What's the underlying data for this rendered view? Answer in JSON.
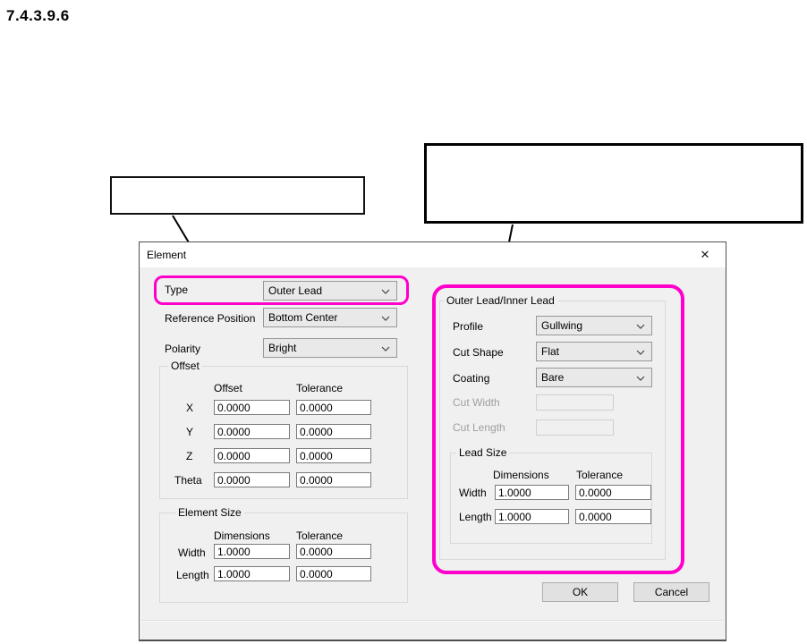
{
  "page": {
    "section_number": "7.4.3.9.6"
  },
  "colors": {
    "highlight": "#ff00cc",
    "dialog_bg": "#f0f0f0",
    "titlebar_bg": "#ffffff"
  },
  "callouts": {
    "left_text": "",
    "right_text": ""
  },
  "dialog": {
    "title": "Element",
    "close_icon": "✕",
    "fields": {
      "type": {
        "label": "Type",
        "value": "Outer Lead"
      },
      "reference_position": {
        "label": "Reference Position",
        "value": "Bottom Center"
      },
      "polarity": {
        "label": "Polarity",
        "value": "Bright"
      }
    },
    "offset_group": {
      "title": "Offset",
      "col1_header": "Offset",
      "col2_header": "Tolerance",
      "rows": [
        {
          "label": "X",
          "offset": "0.0000",
          "tolerance": "0.0000"
        },
        {
          "label": "Y",
          "offset": "0.0000",
          "tolerance": "0.0000"
        },
        {
          "label": "Z",
          "offset": "0.0000",
          "tolerance": "0.0000"
        },
        {
          "label": "Theta",
          "offset": "0.0000",
          "tolerance": "0.0000"
        }
      ]
    },
    "element_size_group": {
      "title": "Element Size",
      "col1_header": "Dimensions",
      "col2_header": "Tolerance",
      "rows": [
        {
          "label": "Width",
          "dimensions": "1.0000",
          "tolerance": "0.0000"
        },
        {
          "label": "Length",
          "dimensions": "1.0000",
          "tolerance": "0.0000"
        }
      ]
    },
    "lead_group": {
      "title": "Outer Lead/Inner Lead",
      "profile": {
        "label": "Profile",
        "value": "Gullwing"
      },
      "cut_shape": {
        "label": "Cut Shape",
        "value": "Flat"
      },
      "coating": {
        "label": "Coating",
        "value": "Bare"
      },
      "cut_width": {
        "label": "Cut Width",
        "value": ""
      },
      "cut_length": {
        "label": "Cut Length",
        "value": ""
      },
      "lead_size_group": {
        "title": "Lead Size",
        "col1_header": "Dimensions",
        "col2_header": "Tolerance",
        "rows": [
          {
            "label": "Width",
            "dimensions": "1.0000",
            "tolerance": "0.0000"
          },
          {
            "label": "Length",
            "dimensions": "1.0000",
            "tolerance": "0.0000"
          }
        ]
      }
    },
    "buttons": {
      "ok": "OK",
      "cancel": "Cancel"
    }
  }
}
